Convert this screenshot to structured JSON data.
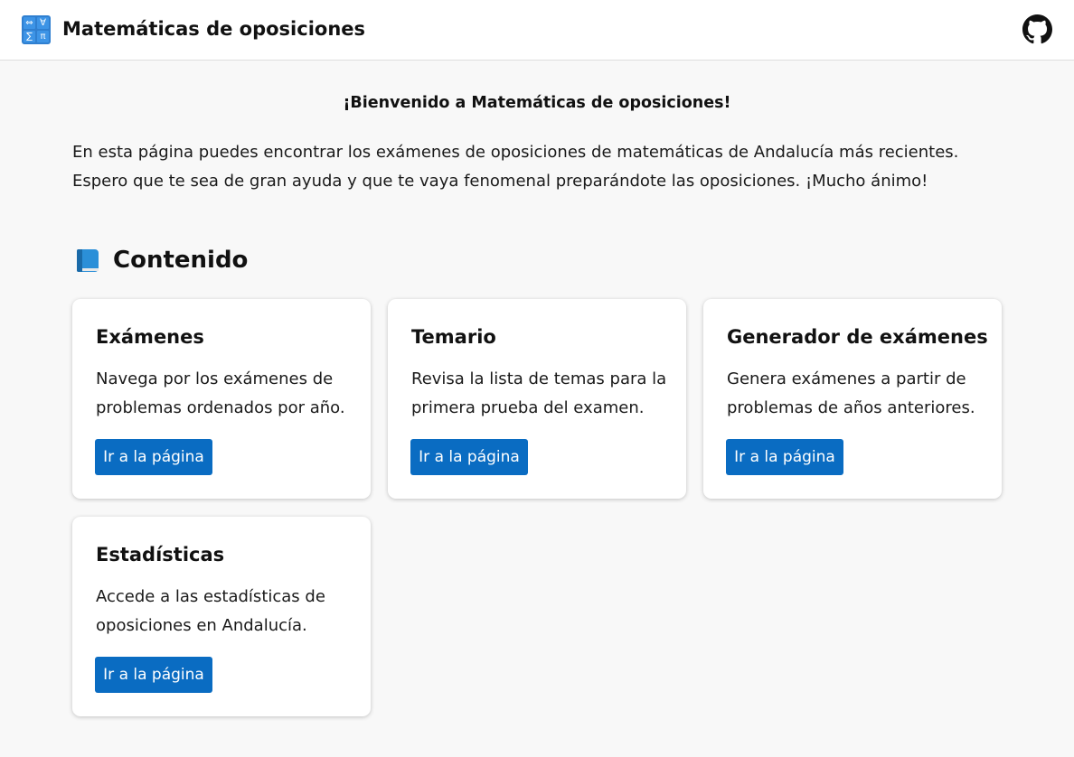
{
  "header": {
    "logo_glyphs": [
      "⇔",
      "∀",
      "∑",
      "π"
    ],
    "title": "Matemáticas de oposiciones",
    "github_icon": "github-icon"
  },
  "main": {
    "welcome": "¡Bienvenido a Matemáticas de oposiciones!",
    "intro": "En esta página puedes encontrar los exámenes de oposiciones de matemáticas de Andalucía más recientes. Espero que te sea de gran ayuda y que te vaya fenomenal preparándote las oposiciones. ¡Mucho ánimo!",
    "section_title": "Contenido",
    "section_icon": "blue-book-icon",
    "cards": [
      {
        "title": "Exámenes",
        "description": "Navega por los exámenes de problemas ordenados por año.",
        "button": "Ir a la página"
      },
      {
        "title": "Temario",
        "description": "Revisa la lista de temas para la primera prueba del examen.",
        "button": "Ir a la página"
      },
      {
        "title": "Generador de exámenes",
        "description": "Genera exámenes a partir de problemas de años anteriores.",
        "button": "Ir a la página"
      },
      {
        "title": "Estadísticas",
        "description": "Accede a las estadísticas de oposiciones en Andalucía.",
        "button": "Ir a la página"
      }
    ]
  },
  "colors": {
    "background": "#f8f8f8",
    "header_bg": "#ffffff",
    "button_bg": "#0a6cc2",
    "logo_blue": "#2f7fd0"
  }
}
